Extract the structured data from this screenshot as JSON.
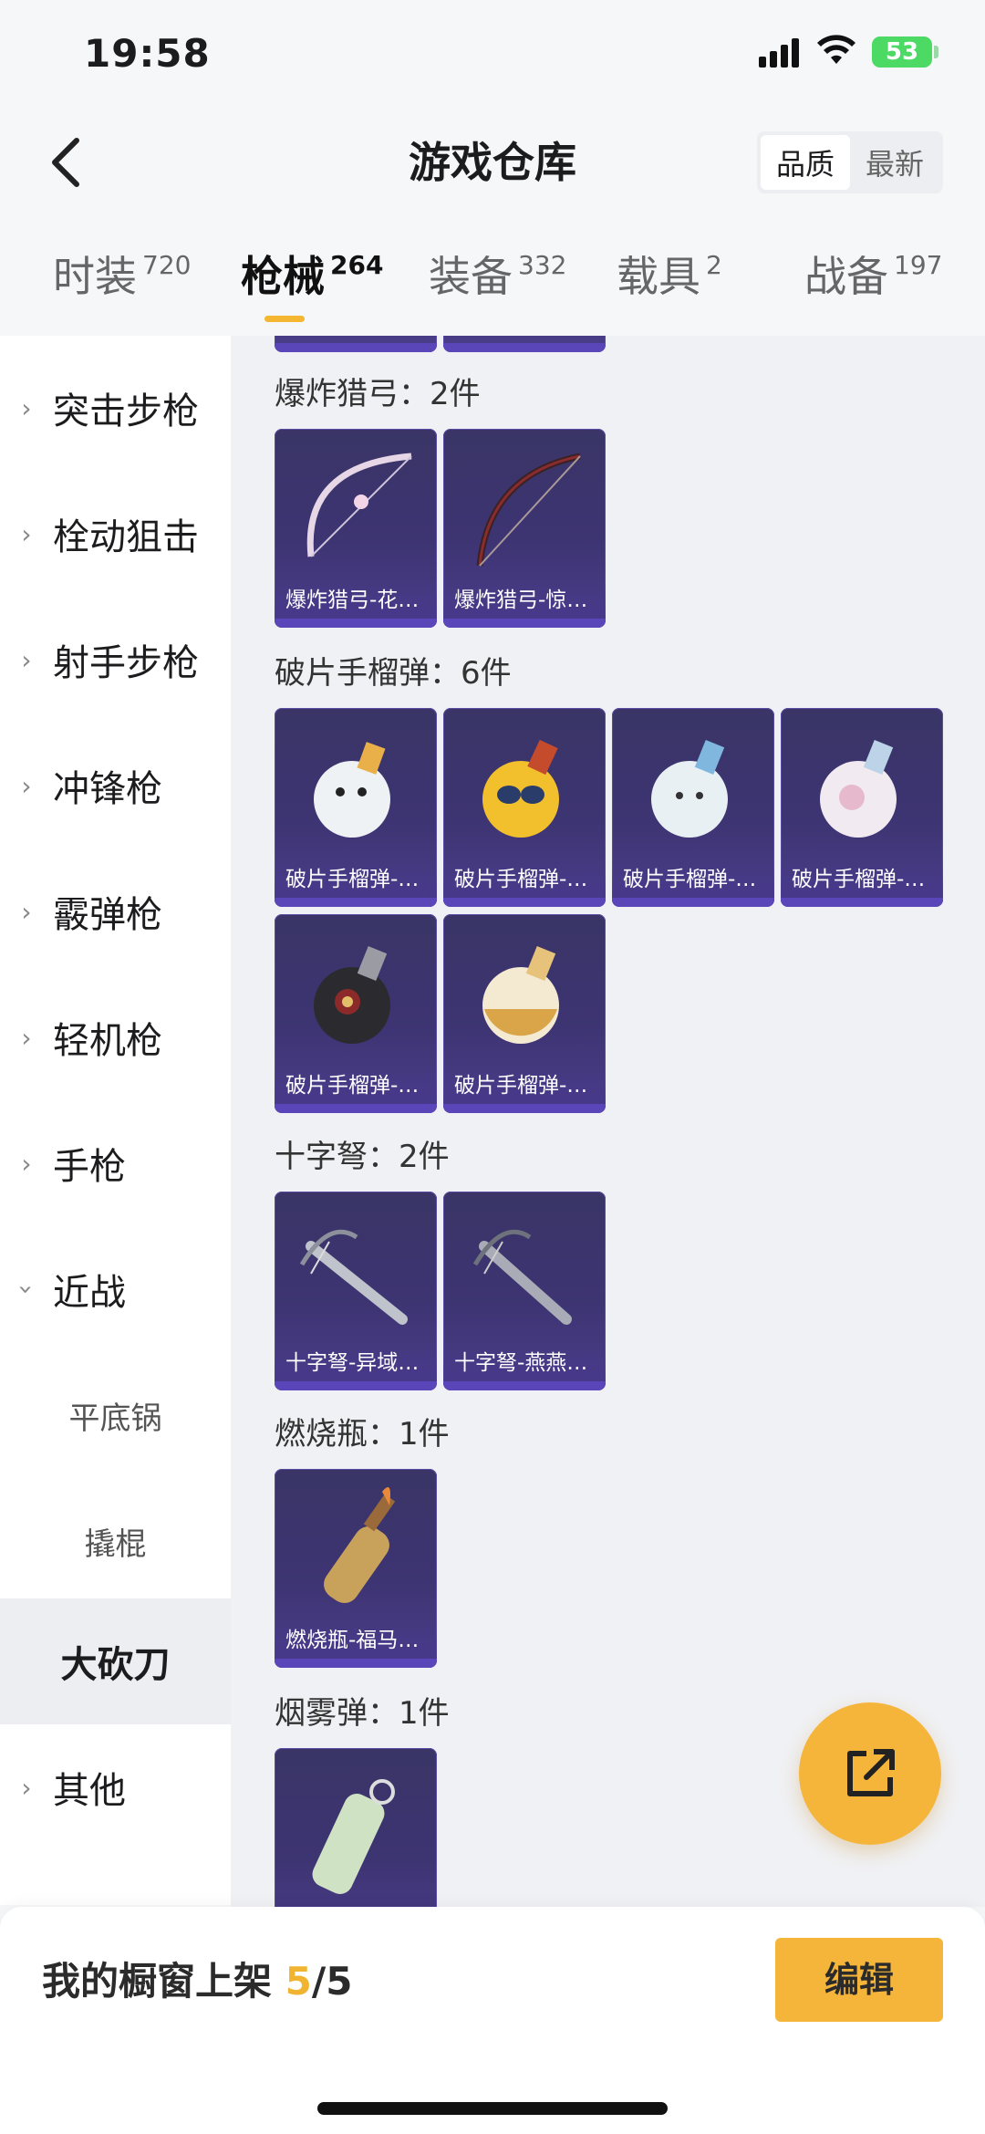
{
  "status": {
    "time": "19:58",
    "battery": "53"
  },
  "header": {
    "title": "游戏仓库",
    "sort": [
      "品质",
      "最新"
    ],
    "sort_active": 0
  },
  "tabs": [
    {
      "label": "时装",
      "count": "720"
    },
    {
      "label": "枪械",
      "count": "264"
    },
    {
      "label": "装备",
      "count": "332"
    },
    {
      "label": "载具",
      "count": "2"
    },
    {
      "label": "战备",
      "count": "197"
    }
  ],
  "active_tab": 1,
  "sidebar": [
    {
      "label": "突击步枪",
      "expanded": false
    },
    {
      "label": "栓动狙击",
      "expanded": false
    },
    {
      "label": "射手步枪",
      "expanded": false
    },
    {
      "label": "冲锋枪",
      "expanded": false
    },
    {
      "label": "霰弹枪",
      "expanded": false
    },
    {
      "label": "轻机枪",
      "expanded": false
    },
    {
      "label": "手枪",
      "expanded": false
    },
    {
      "label": "近战",
      "expanded": true
    },
    {
      "label": "平底锅",
      "sub": true
    },
    {
      "label": "撬棍",
      "sub": true
    },
    {
      "label": "大砍刀",
      "sub": true,
      "active": true
    },
    {
      "label": "其他",
      "expanded": false
    }
  ],
  "sections": [
    {
      "title": "爆炸猎弓：2件",
      "items": [
        "爆炸猎弓-花…",
        "爆炸猎弓-惊…"
      ]
    },
    {
      "title": "破片手榴弹：6件",
      "items": [
        "破片手榴弹-…",
        "破片手榴弹-…",
        "破片手榴弹-…",
        "破片手榴弹-…",
        "破片手榴弹-…",
        "破片手榴弹-…"
      ]
    },
    {
      "title": "十字弩：2件",
      "items": [
        "十字弩-异域…",
        "十字弩-燕燕…"
      ]
    },
    {
      "title": "燃烧瓶：1件",
      "items": [
        "燃烧瓶-福马…"
      ]
    },
    {
      "title": "烟雾弹：1件",
      "items": [
        ""
      ]
    }
  ],
  "bottom": {
    "label": "我的橱窗上架",
    "current": "5",
    "total": "/5",
    "edit": "编辑"
  },
  "colors": {
    "accent": "#f4b53a",
    "card": "#3d3472"
  }
}
